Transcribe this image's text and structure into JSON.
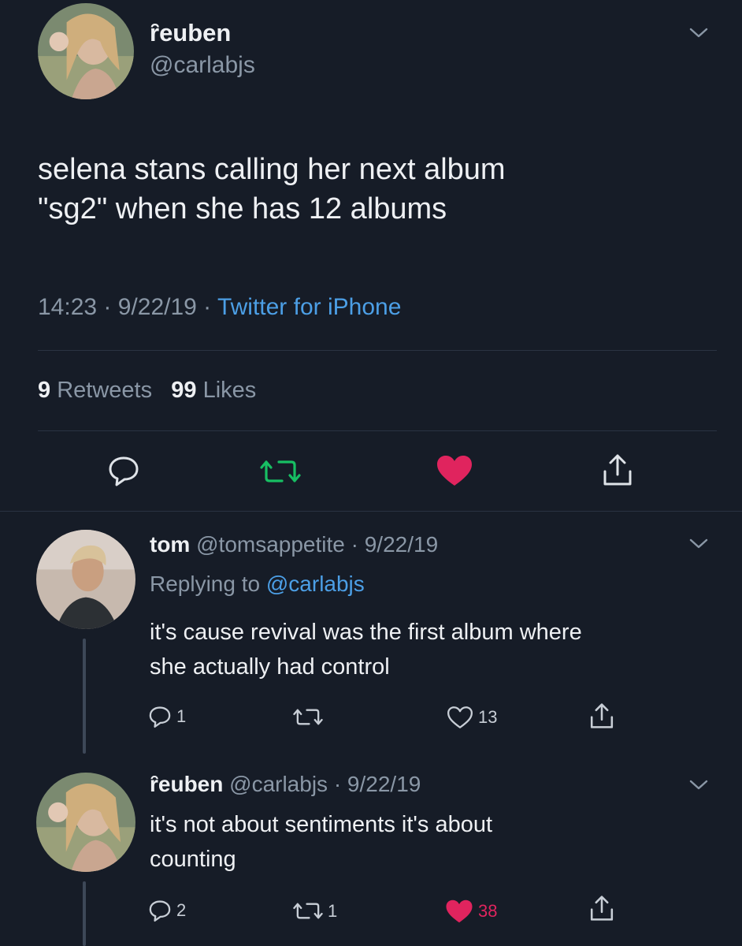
{
  "main_tweet": {
    "display_name": "ȓeuben",
    "handle": "@carlabjs",
    "text_line1": "selena stans calling her next album",
    "text_line2": "\"sg2\" when she has 12 albums",
    "time": "14:23 · 9/22/19 ·",
    "source": "Twitter for iPhone",
    "retweets_count": "9",
    "retweets_label": "Retweets",
    "likes_count": "99",
    "likes_label": "Likes",
    "liked": true,
    "retweeted": true
  },
  "replies": [
    {
      "display_name": "tom",
      "handle_date": "@tomsappetite · 9/22/19",
      "replying_label": "Replying to",
      "replying_to": "@carlabjs",
      "text_line1": "it's cause revival was the first album where",
      "text_line2": "she actually had control",
      "reply_count": "1",
      "retweet_count": "",
      "like_count": "13",
      "liked": false
    },
    {
      "display_name": "ȓeuben",
      "handle_date": "@carlabjs · 9/22/19",
      "text_line1": "it's not about sentiments it's about",
      "text_line2": "counting",
      "reply_count": "2",
      "retweet_count": "1",
      "like_count": "38",
      "liked": true
    }
  ],
  "colors": {
    "background": "#161c27",
    "link": "#4c9fe6",
    "like": "#e0245e",
    "retweet": "#17bf63",
    "muted": "#8a97a6"
  },
  "icons": [
    "chevron-down-icon",
    "reply-icon",
    "retweet-icon",
    "heart-icon",
    "share-icon"
  ]
}
